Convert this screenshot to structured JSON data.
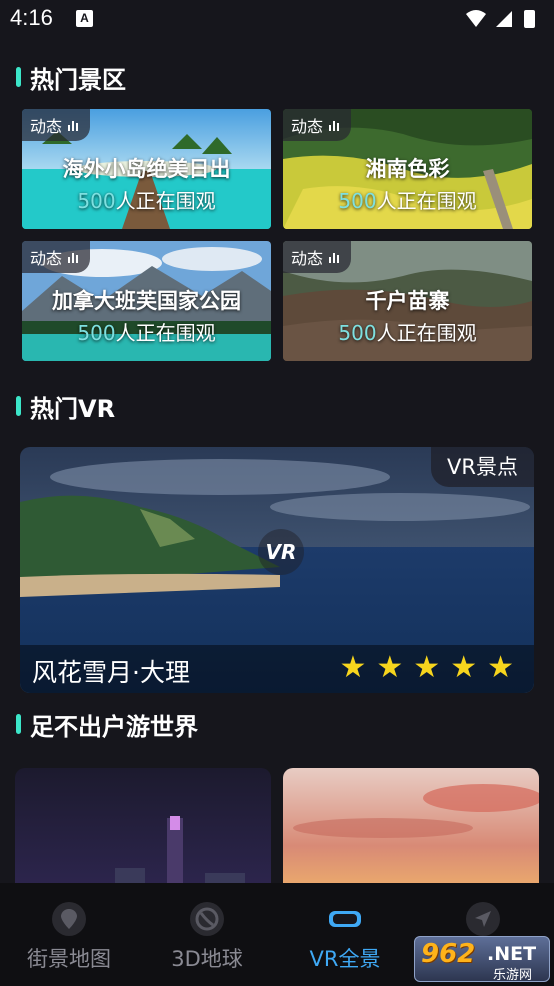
{
  "status_bar": {
    "time": "4:16",
    "notification_icon": "A"
  },
  "sections": {
    "hot_scenic": "热门景区",
    "hot_vr": "热门VR",
    "world": "足不出户游世界"
  },
  "scenic_cards": [
    {
      "badge": "动态",
      "name": "海外小岛绝美日出",
      "viewers_num": "500",
      "viewers_text": "人正在围观"
    },
    {
      "badge": "动态",
      "name": "湘南色彩",
      "viewers_num": "500",
      "viewers_text": "人正在围观"
    },
    {
      "badge": "动态",
      "name": "加拿大班芙国家公园",
      "viewers_num": "500",
      "viewers_text": "人正在围观"
    },
    {
      "badge": "动态",
      "name": "千户苗寨",
      "viewers_num": "500",
      "viewers_text": "人正在围观"
    }
  ],
  "vr_card": {
    "tag": "VR景点",
    "logo": "VR",
    "name": "风花雪月·大理",
    "rating": 5,
    "stars": [
      "★",
      "★",
      "★",
      "★",
      "★"
    ]
  },
  "bottom_nav": [
    {
      "label": "街景地图",
      "icon": "map-pin-icon",
      "active": false
    },
    {
      "label": "3D地球",
      "icon": "globe-icon",
      "active": false
    },
    {
      "label": "VR全景",
      "icon": "vr-goggles-icon",
      "active": true
    },
    {
      "label": "",
      "icon": "navigation-icon",
      "active": false
    }
  ],
  "watermark": {
    "brand": "962",
    "suffix": ".NET",
    "sub": "乐游网"
  },
  "colors": {
    "accent": "#3ce6c9",
    "nav_active": "#3fa9f5",
    "star": "#f7d51d",
    "background": "#16161c"
  }
}
